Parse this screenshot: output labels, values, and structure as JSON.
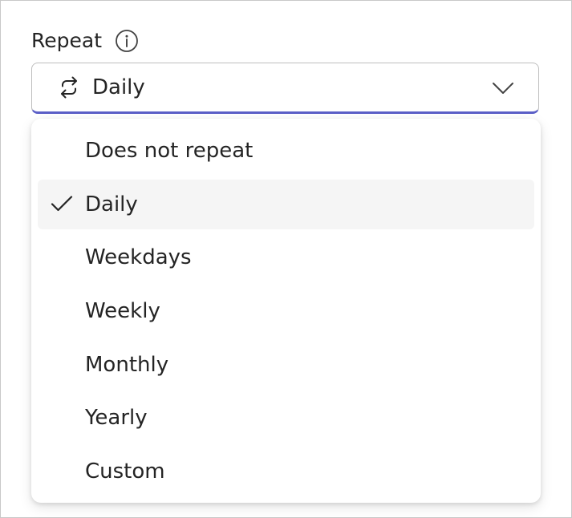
{
  "field": {
    "label": "Repeat",
    "info_icon": "info-icon",
    "value": "Daily",
    "value_icon": "repeat-icon",
    "accent_color": "#5b5fc7"
  },
  "dropdown": {
    "options": [
      {
        "label": "Does not repeat",
        "selected": false
      },
      {
        "label": "Daily",
        "selected": true
      },
      {
        "label": "Weekdays",
        "selected": false
      },
      {
        "label": "Weekly",
        "selected": false
      },
      {
        "label": "Monthly",
        "selected": false
      },
      {
        "label": "Yearly",
        "selected": false
      },
      {
        "label": "Custom",
        "selected": false
      }
    ]
  }
}
